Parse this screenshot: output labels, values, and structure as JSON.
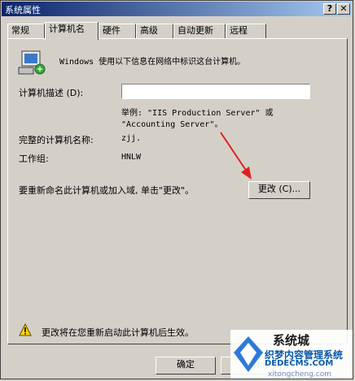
{
  "window": {
    "title": "系统属性",
    "help_label": "?",
    "close_label": "✕"
  },
  "tabs": [
    {
      "label": "常规"
    },
    {
      "label": "计算机名"
    },
    {
      "label": "硬件"
    },
    {
      "label": "高级"
    },
    {
      "label": "自动更新"
    },
    {
      "label": "远程"
    }
  ],
  "active_tab": "计算机名",
  "panel": {
    "intro": "Windows 使用以下信息在网络中标识这台计算机。",
    "description_label": "计算机描述 (D):",
    "description_value": "",
    "example_line1": "举例: \"IIS Production Server\" 或",
    "example_line2": "\"Accounting Server\"。",
    "full_name_label": "完整的计算机名称:",
    "full_name_value": "zjj.",
    "workgroup_label": "工作组:",
    "workgroup_value": "HNLW",
    "rename_text": "要重新命名此计算机或加入域, 单击\"更改\"。",
    "change_button": "更改 (C)...",
    "warning_text": "更改将在您重新启动此计算机后生效。"
  },
  "buttons": {
    "ok": "确定",
    "cancel": "取消"
  },
  "watermark": {
    "main": "系统城",
    "line1": "织梦内容管理系统",
    "line2": "DEDECMS.COM",
    "line3": "xitongcheng.com"
  },
  "colors": {
    "face": "#d4d0c8",
    "title_start": "#0a246a",
    "title_end": "#a6caf0",
    "arrow": "#e02020"
  }
}
